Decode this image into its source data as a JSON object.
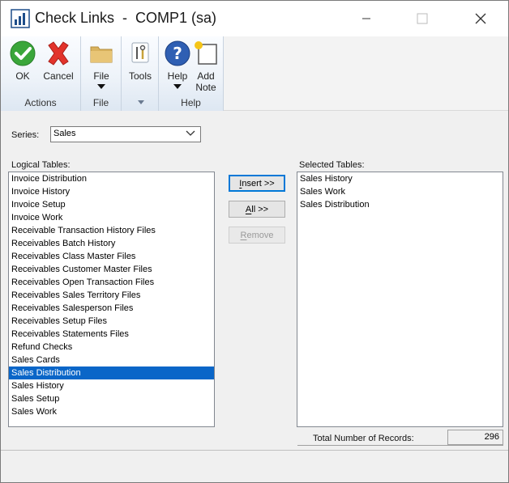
{
  "window": {
    "title": "Check Links  -  COMP1 (sa)"
  },
  "ribbon": {
    "groups": [
      {
        "label": "Actions",
        "buttons": [
          {
            "label": "OK",
            "icon": "ok-check-icon"
          },
          {
            "label": "Cancel",
            "icon": "cancel-x-icon"
          }
        ]
      },
      {
        "label": "File",
        "buttons": [
          {
            "label": "File",
            "icon": "folder-icon"
          }
        ]
      },
      {
        "label": "",
        "buttons": [
          {
            "label": "Tools",
            "icon": "tools-icon"
          }
        ]
      },
      {
        "label": "Help",
        "buttons": [
          {
            "label": "Help",
            "icon": "help-icon"
          },
          {
            "label": "Add Note",
            "line1": "Add",
            "line2": "Note",
            "icon": "add-note-icon"
          }
        ]
      }
    ]
  },
  "series": {
    "label": "Series:",
    "value": "Sales"
  },
  "logical_tables": {
    "label": "Logical Tables:",
    "items": [
      "Invoice Distribution",
      "Invoice History",
      "Invoice Setup",
      "Invoice Work",
      "Receivable Transaction History Files",
      "Receivables Batch History",
      "Receivables Class Master Files",
      "Receivables Customer Master Files",
      "Receivables Open Transaction Files",
      "Receivables Sales Territory Files",
      "Receivables Salesperson Files",
      "Receivables Setup Files",
      "Receivables Statements Files",
      "Refund Checks",
      "Sales Cards",
      "Sales Distribution",
      "Sales History",
      "Sales Setup",
      "Sales Work"
    ],
    "selected_index": 15
  },
  "buttons": {
    "insert": {
      "accel": "I",
      "rest": "nsert >>"
    },
    "all": {
      "accel": "A",
      "rest": "ll >>"
    },
    "remove": {
      "accel": "R",
      "rest": "emove"
    }
  },
  "selected_tables": {
    "label": "Selected Tables:",
    "items": [
      "Sales History",
      "Sales Work",
      "Sales Distribution"
    ]
  },
  "totals": {
    "label": "Total Number of Records:",
    "value": "296"
  },
  "colors": {
    "selection": "#0a66c8",
    "ribbon_gradient_bottom": "#dde7f2",
    "default_button_border": "#0078d7"
  }
}
